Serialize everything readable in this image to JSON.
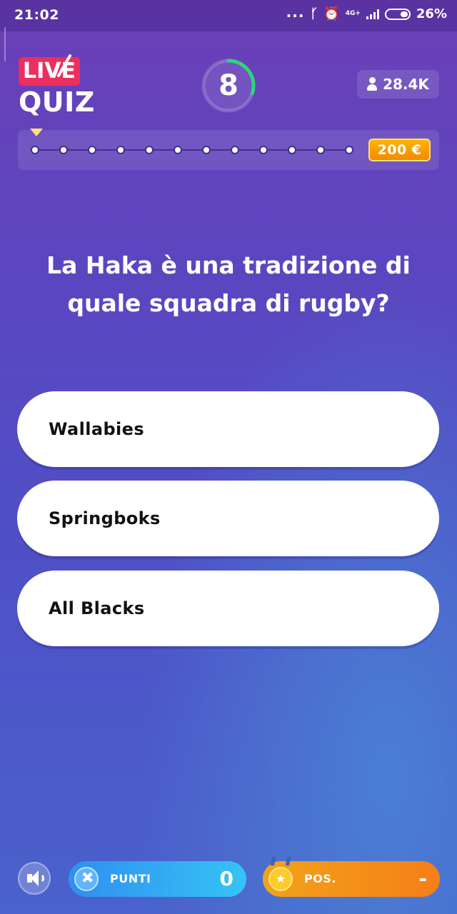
{
  "status_bar": {
    "time": "21:02",
    "dots": "...",
    "network_label": "4G+",
    "battery_percent": "26%"
  },
  "header": {
    "logo_live": "LIVE",
    "logo_quiz": "QUIZ",
    "timer_value": "8",
    "timer_progress": 0.3,
    "viewers": "28.4K"
  },
  "progress": {
    "steps": 12,
    "current_step": 1,
    "prize": "200 €"
  },
  "question": "La Haka è una tradizione di quale squadra di rugby?",
  "answers": [
    {
      "label": "Wallabies"
    },
    {
      "label": "Springboks"
    },
    {
      "label": "All Blacks"
    }
  ],
  "bottom_bar": {
    "points_label": "PUNTI",
    "points_value": "0",
    "position_label": "POS.",
    "position_value": "-"
  },
  "colors": {
    "accent_live": "#ec2f5f",
    "timer_ring": "#2ed47a",
    "prize": "#f28a00",
    "points_pill": "#2f8ff0",
    "position_pill": "#f57f17"
  }
}
